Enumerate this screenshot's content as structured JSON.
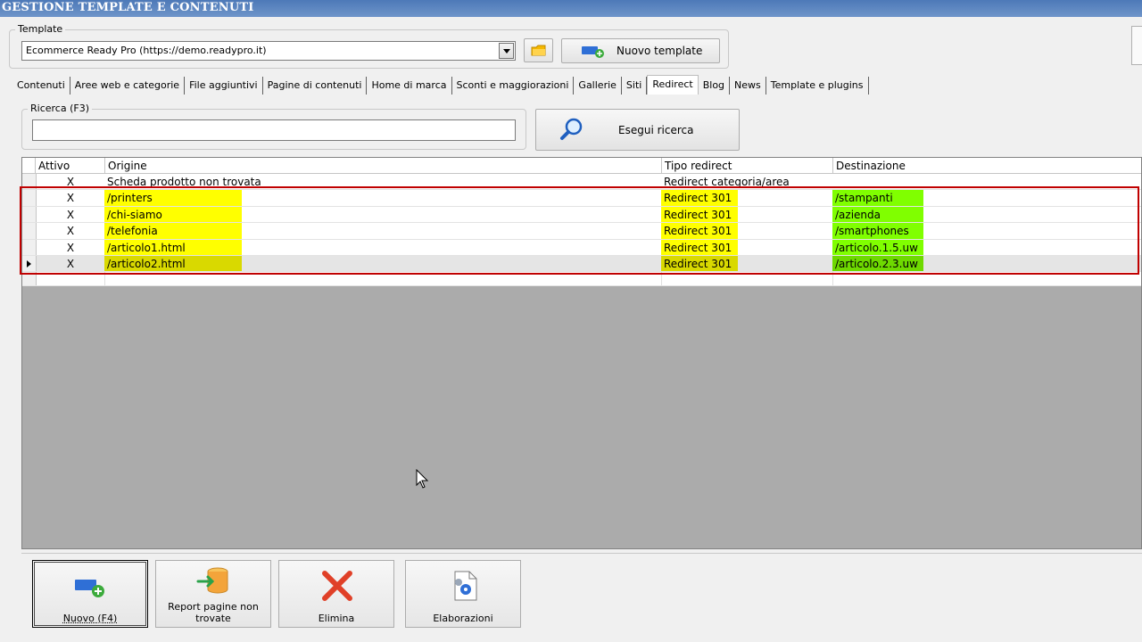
{
  "window": {
    "title": "GESTIONE TEMPLATE E CONTENUTI"
  },
  "template_group": {
    "label": "Template",
    "selected": "Ecommerce Ready Pro (https://demo.readypro.it)",
    "new_button": "Nuovo template"
  },
  "tabs": [
    {
      "label": "Contenuti"
    },
    {
      "label": "Aree web e categorie"
    },
    {
      "label": "File aggiuntivi"
    },
    {
      "label": "Pagine di contenuti"
    },
    {
      "label": "Home di marca"
    },
    {
      "label": "Sconti e maggiorazioni"
    },
    {
      "label": "Gallerie"
    },
    {
      "label": "Siti"
    },
    {
      "label": "Redirect"
    },
    {
      "label": "Blog"
    },
    {
      "label": "News"
    },
    {
      "label": "Template e plugins"
    }
  ],
  "active_tab": "Redirect",
  "search": {
    "label": "Ricerca (F3)",
    "value": "",
    "button": "Esegui ricerca"
  },
  "grid": {
    "columns": [
      "Attivo",
      "Origine",
      "Tipo redirect",
      "Destinazione"
    ],
    "rows": [
      {
        "attivo": "X",
        "origine": "Scheda prodotto non trovata",
        "tipo": "Redirect categoria/area",
        "destinazione": ""
      },
      {
        "attivo": "X",
        "origine": "/printers",
        "tipo": "Redirect 301",
        "destinazione": "/stampanti"
      },
      {
        "attivo": "X",
        "origine": "/chi-siamo",
        "tipo": "Redirect 301",
        "destinazione": "/azienda"
      },
      {
        "attivo": "X",
        "origine": "/telefonia",
        "tipo": "Redirect 301",
        "destinazione": "/smartphones"
      },
      {
        "attivo": "X",
        "origine": "/articolo1.html",
        "tipo": "Redirect 301",
        "destinazione": "/articolo.1.5.uw"
      },
      {
        "attivo": "X",
        "origine": "/articolo2.html",
        "tipo": "Redirect 301",
        "destinazione": "/articolo.2.3.uw"
      }
    ]
  },
  "toolbar": {
    "new": "Nuovo (F4)",
    "report_line1": "Report pagine non",
    "report_line2": "trovate",
    "delete": "Elimina",
    "process": "Elaborazioni"
  },
  "colors": {
    "title_bar": "#5b84bf",
    "highlight_yellow": "#ffff00",
    "highlight_green": "#80ff00",
    "annotation_red": "#c00000"
  }
}
